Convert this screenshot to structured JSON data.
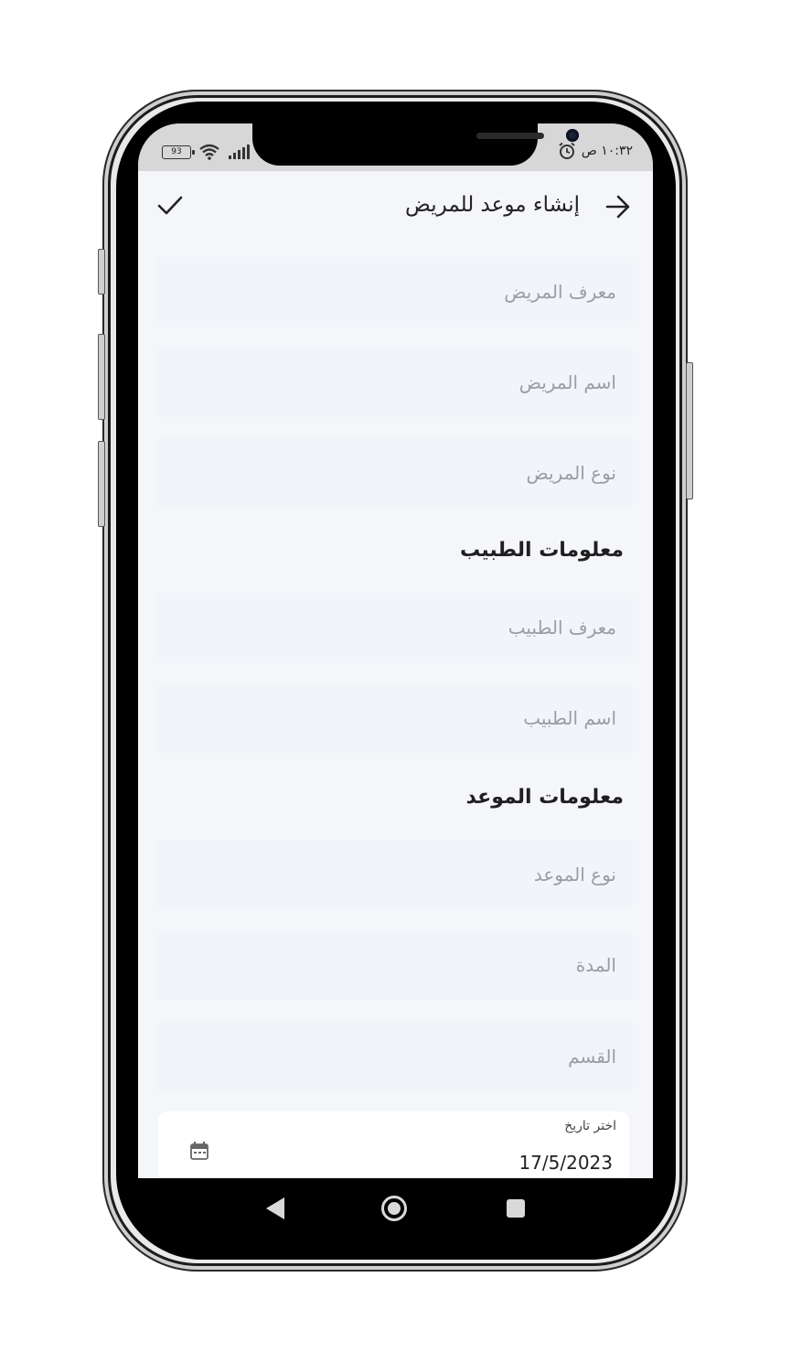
{
  "status_bar": {
    "battery": "93",
    "time": "١٠:٣٢ ص"
  },
  "header": {
    "title": "إنشاء موعد للمريض"
  },
  "patient_fields": [
    {
      "placeholder": "معرف المريض"
    },
    {
      "placeholder": "اسم المريض"
    },
    {
      "placeholder": "نوع المريض"
    }
  ],
  "doctor_section": {
    "title": "معلومات الطبيب",
    "fields": [
      {
        "placeholder": "معرف الطبيب"
      },
      {
        "placeholder": "اسم الطبيب"
      }
    ]
  },
  "appointment_section": {
    "title": "معلومات الموعد",
    "fields": [
      {
        "placeholder": "نوع الموعد"
      },
      {
        "placeholder": "المدة"
      },
      {
        "placeholder": "القسم"
      }
    ]
  },
  "date_picker": {
    "label": "اختر تاريخ",
    "value": "17/5/2023"
  },
  "colors": {
    "screen_bg": "#f5f6fa",
    "status_bar_bg": "#d7d7d7",
    "text": "#222222",
    "placeholder": "#9a9da5"
  },
  "icons": [
    "back-arrow-icon",
    "check-icon",
    "calendar-icon",
    "wifi-icon",
    "signal-icon",
    "alarm-icon",
    "nav-back-icon",
    "nav-home-icon",
    "nav-recents-icon"
  ]
}
